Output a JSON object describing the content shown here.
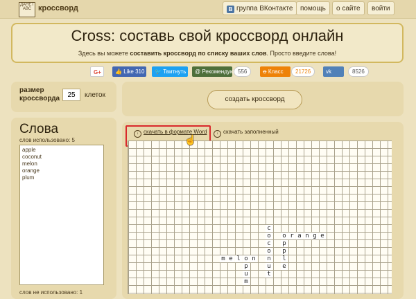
{
  "header": {
    "logo_text": "ДАНЕТ АВС",
    "brand": "кроссворд",
    "nav": [
      {
        "label": "группа ВКонтакте",
        "icon": "vk-icon"
      },
      {
        "label": "помощь"
      },
      {
        "label": "о сайте"
      },
      {
        "label": "войти"
      }
    ]
  },
  "hero": {
    "title": "Cross: составь свой кроссворд онлайн",
    "subtitle_pre": "Здесь вы можете ",
    "subtitle_bold": "составить кроссворд по списку ваших слов",
    "subtitle_post": ". Просто введите слова!"
  },
  "social": {
    "gplus": "G+",
    "fb_like": "Like 310",
    "twitter": "Твитнуть",
    "recommend": "Рекомендую",
    "recommend_count": "556",
    "ok": "Класс",
    "ok_count": "21726",
    "vk": "",
    "vk_count": "8526"
  },
  "controls": {
    "size_label_1": "размер",
    "size_label_2": "кроссворда",
    "size_value": "25",
    "size_unit": "клеток",
    "create_button": "создать кроссворд"
  },
  "words": {
    "title": "Слова",
    "used_label": "слов использовано: 5",
    "list": [
      "apple",
      "coconut",
      "melon",
      "orange",
      "plum"
    ],
    "unused_label": "слов не использовано: 1"
  },
  "downloads": {
    "word": "скачать в формате Word",
    "filled": "скачать заполненный"
  },
  "crossword": {
    "cols": 34,
    "rows": 20,
    "letters": [
      {
        "r": 11,
        "c": 18,
        "ch": "c"
      },
      {
        "r": 12,
        "c": 18,
        "ch": "o"
      },
      {
        "r": 12,
        "c": 20,
        "ch": "o"
      },
      {
        "r": 12,
        "c": 21,
        "ch": "r"
      },
      {
        "r": 12,
        "c": 22,
        "ch": "a"
      },
      {
        "r": 12,
        "c": 23,
        "ch": "n"
      },
      {
        "r": 12,
        "c": 24,
        "ch": "g"
      },
      {
        "r": 12,
        "c": 25,
        "ch": "e"
      },
      {
        "r": 13,
        "c": 18,
        "ch": "c"
      },
      {
        "r": 13,
        "c": 20,
        "ch": "p"
      },
      {
        "r": 14,
        "c": 18,
        "ch": "o"
      },
      {
        "r": 14,
        "c": 20,
        "ch": "p"
      },
      {
        "r": 15,
        "c": 12,
        "ch": "m"
      },
      {
        "r": 15,
        "c": 13,
        "ch": "e"
      },
      {
        "r": 15,
        "c": 14,
        "ch": "l"
      },
      {
        "r": 15,
        "c": 15,
        "ch": "o"
      },
      {
        "r": 15,
        "c": 16,
        "ch": "n"
      },
      {
        "r": 15,
        "c": 18,
        "ch": "n"
      },
      {
        "r": 15,
        "c": 20,
        "ch": "l"
      },
      {
        "r": 16,
        "c": 15,
        "ch": "p"
      },
      {
        "r": 16,
        "c": 18,
        "ch": "u"
      },
      {
        "r": 16,
        "c": 20,
        "ch": "e"
      },
      {
        "r": 17,
        "c": 15,
        "ch": "u"
      },
      {
        "r": 17,
        "c": 18,
        "ch": "t"
      },
      {
        "r": 18,
        "c": 15,
        "ch": "m"
      }
    ]
  }
}
